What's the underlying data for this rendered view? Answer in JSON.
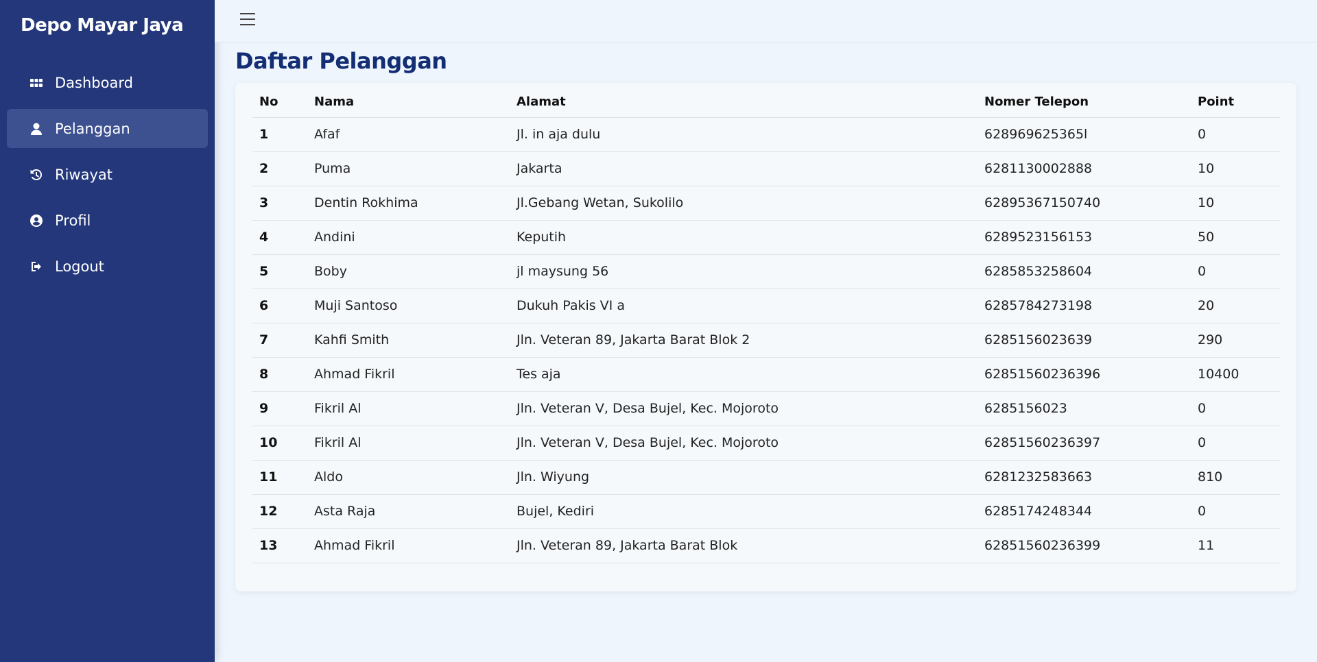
{
  "sidebar": {
    "brand": "Depo Mayar Jaya",
    "items": [
      {
        "label": "Dashboard",
        "icon": "grid-icon",
        "active": false
      },
      {
        "label": "Pelanggan",
        "icon": "user-icon",
        "active": true
      },
      {
        "label": "Riwayat",
        "icon": "history-icon",
        "active": false
      },
      {
        "label": "Profil",
        "icon": "user-circle-icon",
        "active": false
      },
      {
        "label": "Logout",
        "icon": "logout-icon",
        "active": false
      }
    ]
  },
  "header": {
    "menu_icon": "hamburger-icon"
  },
  "main": {
    "title": "Daftar Pelanggan",
    "table": {
      "columns": [
        "No",
        "Nama",
        "Alamat",
        "Nomer Telepon",
        "Point"
      ],
      "rows": [
        [
          "1",
          "Afaf",
          "Jl. in aja dulu",
          "628969625365l",
          "0"
        ],
        [
          "2",
          "Puma",
          "Jakarta",
          "6281130002888",
          "10"
        ],
        [
          "3",
          "Dentin Rokhima",
          "Jl.Gebang Wetan, Sukolilo",
          "62895367150740",
          "10"
        ],
        [
          "4",
          "Andini",
          "Keputih",
          "6289523156153",
          "50"
        ],
        [
          "5",
          "Boby",
          "jl maysung 56",
          "6285853258604",
          "0"
        ],
        [
          "6",
          "Muji Santoso",
          "Dukuh Pakis VI a",
          "6285784273198",
          "20"
        ],
        [
          "7",
          "Kahfi Smith",
          "Jln. Veteran 89, Jakarta Barat Blok 2",
          "6285156023639",
          "290"
        ],
        [
          "8",
          "Ahmad Fikril",
          "Tes aja",
          "62851560236396",
          "10400"
        ],
        [
          "9",
          "Fikril Al",
          "Jln. Veteran V, Desa Bujel, Kec. Mojoroto",
          "6285156023",
          "0"
        ],
        [
          "10",
          "Fikril Al",
          "Jln. Veteran V, Desa Bujel, Kec. Mojoroto",
          "62851560236397",
          "0"
        ],
        [
          "11",
          "Aldo",
          "Jln. Wiyung",
          "6281232583663",
          "810"
        ],
        [
          "12",
          "Asta Raja",
          "Bujel, Kediri",
          "6285174248344",
          "0"
        ],
        [
          "13",
          "Ahmad Fikril",
          "Jln. Veteran 89, Jakarta Barat Blok",
          "62851560236399",
          "11"
        ]
      ]
    }
  },
  "colors": {
    "sidebar_bg": "#23377a",
    "sidebar_active": "#3d5191",
    "title": "#142e74",
    "page_bg": "#eef5fd"
  }
}
